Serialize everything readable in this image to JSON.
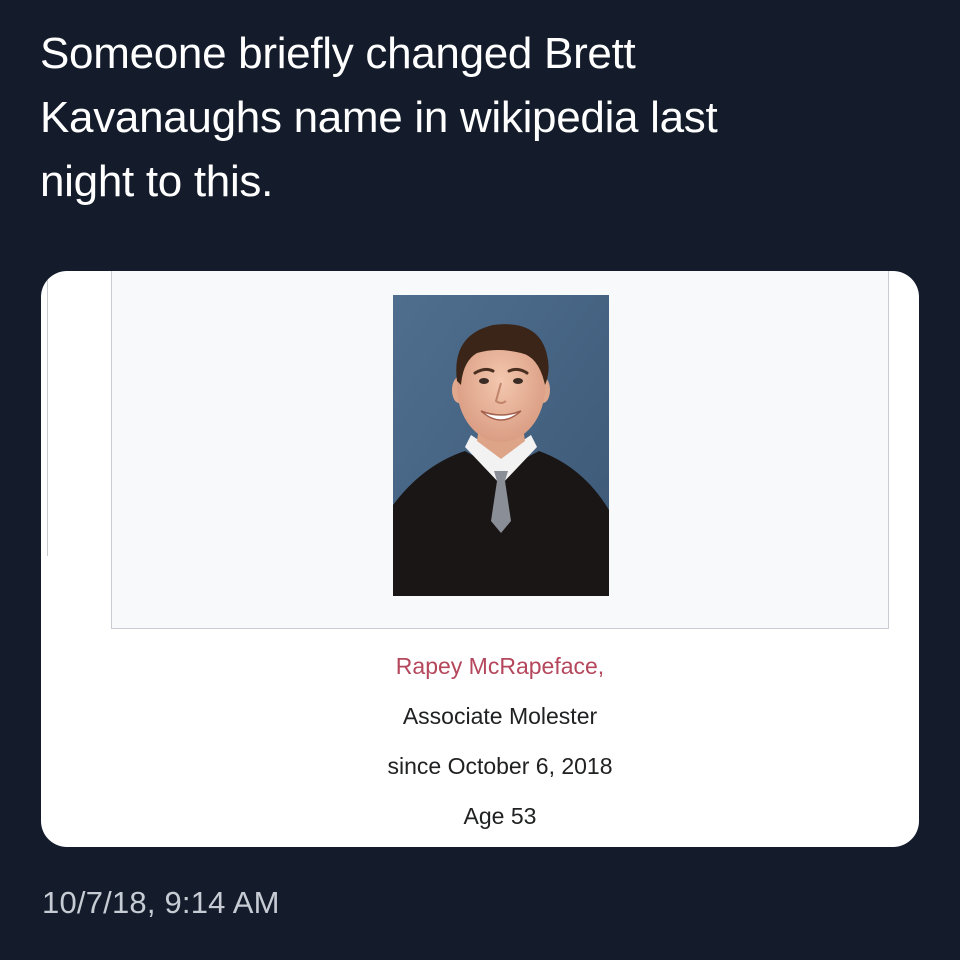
{
  "tweet": {
    "text_lines": [
      "Someone briefly changed Brett",
      "Kavanaughs name in wikipedia last",
      "night to this."
    ],
    "timestamp": "10/7/18, 9:14 AM"
  },
  "infobox": {
    "name_line": "Rapey McRapeface,",
    "title_line": "Associate Molester",
    "since_line": "since October 6, 2018",
    "age_line": "Age 53",
    "name_color": "#b5475d"
  },
  "colors": {
    "background": "#141c2b",
    "tweet_text": "#ffffff",
    "timestamp": "#c7ccd4",
    "card": "#ffffff",
    "frame_border": "#c8ccd1"
  }
}
